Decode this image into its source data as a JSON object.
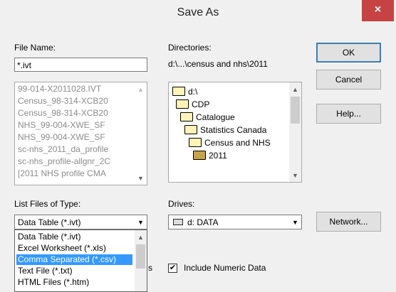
{
  "window": {
    "title": "Save As",
    "close_glyph": "×"
  },
  "file_name": {
    "label": "File Name:",
    "value": "*.ivt",
    "files": [
      "99-014-X2011028.IVT",
      "Census_98-314-XCB20",
      "Census_98-314-XCB20",
      "NHS_99-004-XWE_SF",
      "NHS_99-004-XWE_SF",
      "sc-nhs_2011_da_profile",
      "sc-nhs_profile-allgnr_2C",
      "[2011 NHS profile CMA"
    ]
  },
  "directories": {
    "label": "Directories:",
    "path": "d:\\...\\census and nhs\\2011",
    "tree": [
      {
        "label": "d:\\",
        "icon": "open-folder-icon"
      },
      {
        "label": "CDP",
        "icon": "open-folder-icon"
      },
      {
        "label": "Catalogue",
        "icon": "open-folder-icon"
      },
      {
        "label": "Statistics Canada",
        "icon": "open-folder-icon"
      },
      {
        "label": "Census and NHS",
        "icon": "open-folder-icon"
      },
      {
        "label": "2011",
        "icon": "open-folder-selected-icon"
      }
    ]
  },
  "buttons": {
    "ok": "OK",
    "cancel": "Cancel",
    "help": "Help...",
    "network": "Network..."
  },
  "file_type": {
    "label": "List Files of Type:",
    "selected": "Data Table (*.ivt)",
    "options": [
      "Data Table (*.ivt)",
      "Excel Worksheet (*.xls)",
      "Comma Separated (*.csv)",
      "Text File (*.txt)",
      "HTML Files (*.htm)"
    ],
    "highlighted_option": "Comma Separated (*.csv)",
    "partial_label": "s"
  },
  "drives": {
    "label": "Drives:",
    "selected": "d: DATA",
    "icon": "drive-icon"
  },
  "include_numeric": {
    "label": "Include Numeric Data",
    "checked": true,
    "check_glyph": "✔"
  },
  "colors": {
    "close": "#c74343",
    "highlight": "#3399ff"
  }
}
